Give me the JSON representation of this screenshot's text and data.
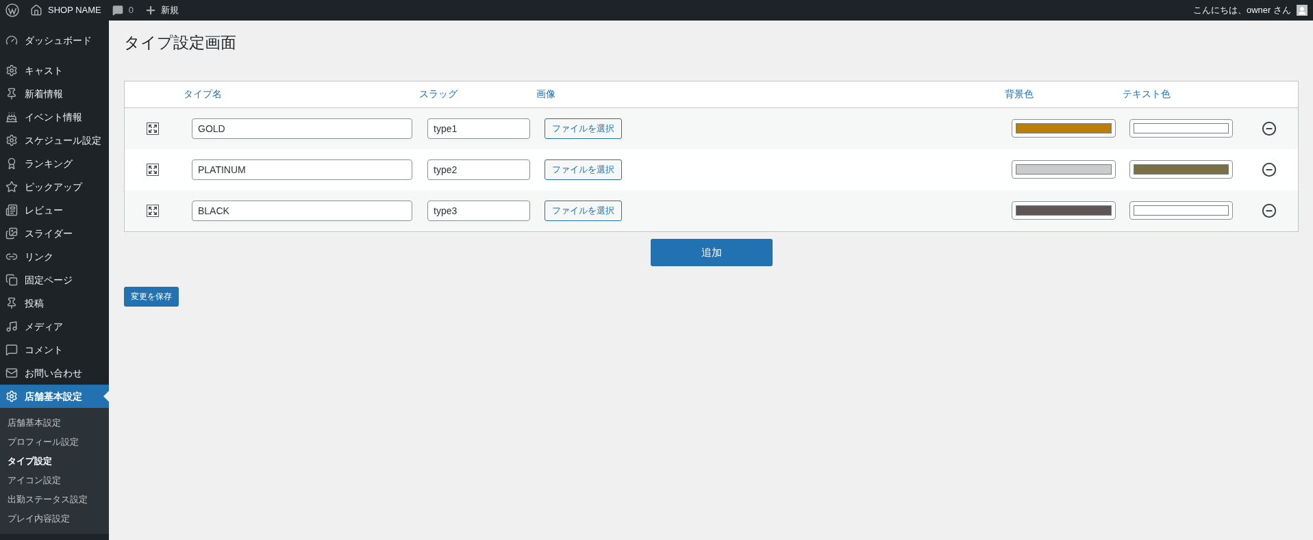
{
  "admin_bar": {
    "site_name": "SHOP NAME",
    "comments_count": "0",
    "new_label": "新規",
    "greeting": "こんにちは、owner さん"
  },
  "sidebar": {
    "items": [
      {
        "label": "ダッシュボード",
        "selected": false
      },
      {
        "label": "キャスト",
        "selected": false
      },
      {
        "label": "新着情報",
        "selected": false
      },
      {
        "label": "イベント情報",
        "selected": false
      },
      {
        "label": "スケジュール設定",
        "selected": false
      },
      {
        "label": "ランキング",
        "selected": false
      },
      {
        "label": "ピックアップ",
        "selected": false
      },
      {
        "label": "レビュー",
        "selected": false
      },
      {
        "label": "スライダー",
        "selected": false
      },
      {
        "label": "リンク",
        "selected": false
      },
      {
        "label": "固定ページ",
        "selected": false
      },
      {
        "label": "投稿",
        "selected": false
      },
      {
        "label": "メディア",
        "selected": false
      },
      {
        "label": "コメント",
        "selected": false
      },
      {
        "label": "お問い合わせ",
        "selected": false
      },
      {
        "label": "店舗基本設定",
        "selected": true
      }
    ],
    "submenu": [
      {
        "label": "店舗基本設定",
        "selected": false
      },
      {
        "label": "プロフィール設定",
        "selected": false
      },
      {
        "label": "タイプ設定",
        "selected": true
      },
      {
        "label": "アイコン設定",
        "selected": false
      },
      {
        "label": "出勤ステータス設定",
        "selected": false
      },
      {
        "label": "プレイ内容設定",
        "selected": false
      }
    ]
  },
  "page_title": "タイプ設定画面",
  "table": {
    "columns": [
      "タイプ名",
      "スラッグ",
      "画像",
      "背景色",
      "テキスト色"
    ],
    "rows": [
      {
        "name": "GOLD",
        "slug": "type1",
        "file_button": "ファイルを選択",
        "background_swatch": {
          "color": "#bc7f05"
        },
        "text_swatch": {
          "color": "#ffffff"
        }
      },
      {
        "name": "PLATINUM",
        "slug": "type2",
        "file_button": "ファイルを選択",
        "background_swatch": {
          "color": "#cccbcb"
        },
        "text_swatch": {
          "color": "#7b6f44"
        }
      },
      {
        "name": "BLACK",
        "slug": "type3",
        "file_button": "ファイルを選択",
        "background_swatch": {
          "color": "#5f5555"
        },
        "text_swatch": {
          "color": "#ffffff"
        }
      }
    ]
  },
  "add_button": "追加",
  "save_button": "変更を保存"
}
